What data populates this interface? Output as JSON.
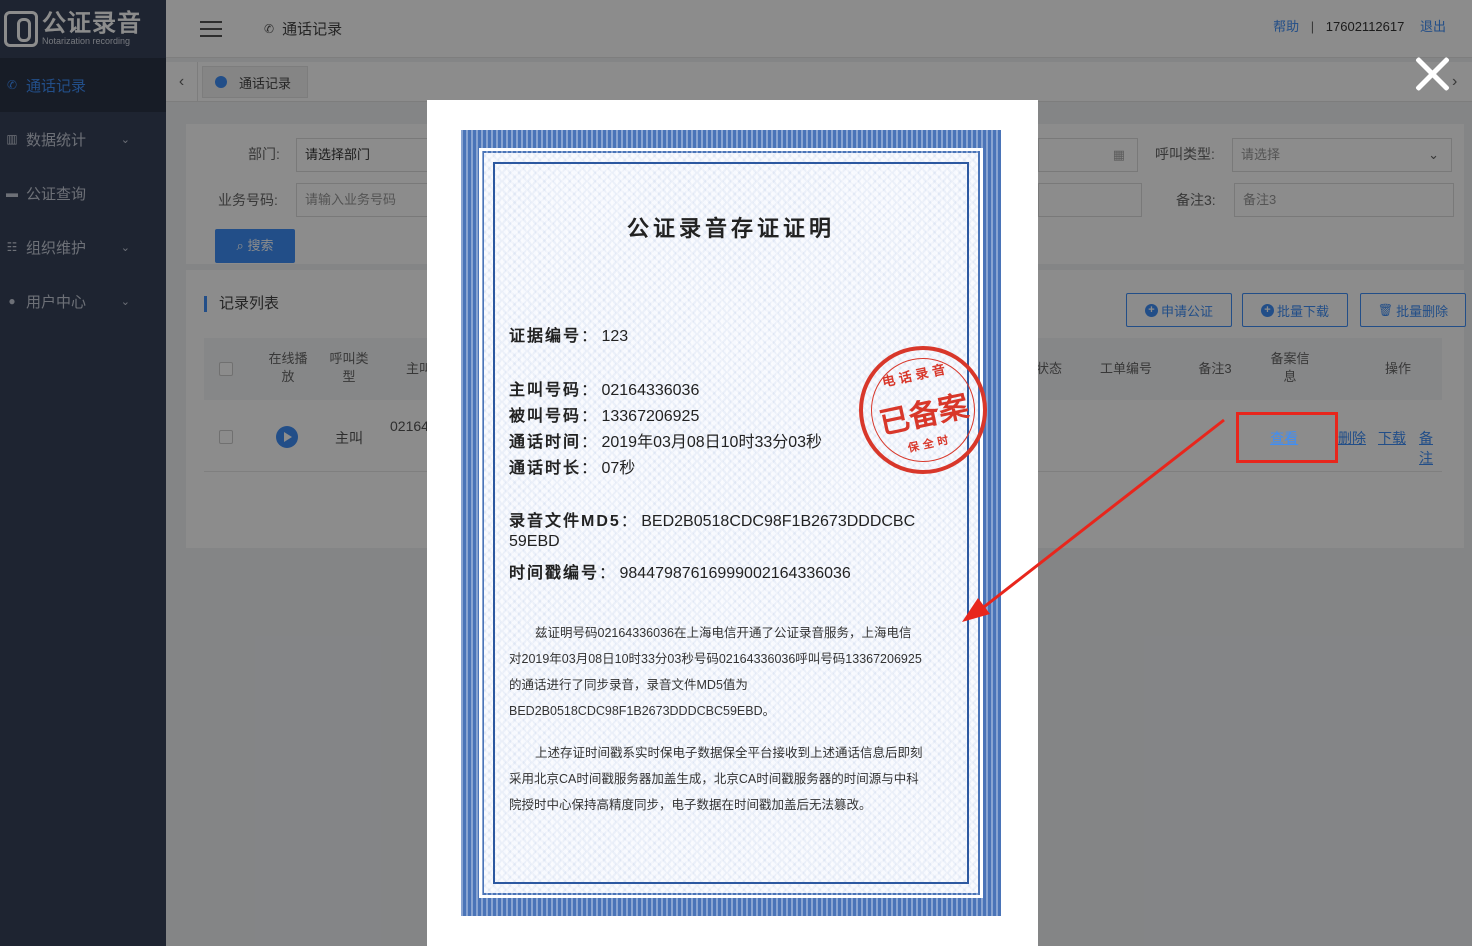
{
  "app": {
    "logo_title": "公证录音",
    "logo_sub": "Notarization recording"
  },
  "sidebar": {
    "items": [
      {
        "label": "通话记录",
        "icon": "phone-icon",
        "active": true
      },
      {
        "label": "数据统计",
        "icon": "bar-chart-icon",
        "caret": true
      },
      {
        "label": "公证查询",
        "icon": "monitor-icon"
      },
      {
        "label": "组织维护",
        "icon": "sliders-icon",
        "caret": true
      },
      {
        "label": "用户中心",
        "icon": "user-icon",
        "caret": true
      }
    ]
  },
  "header": {
    "breadcrumb": "通话记录",
    "help": "帮助",
    "separator": "|",
    "phone": "17602112617",
    "logout": "退出"
  },
  "tabs": [
    {
      "label": "通话记录"
    }
  ],
  "filters": {
    "dept_label": "部门:",
    "dept_value": "请选择部门",
    "bizno_label": "业务号码:",
    "bizno_placeholder": "请输入业务号码",
    "call_type_label": "呼叫类型:",
    "call_type_placeholder": "请选择",
    "remark3_label": "备注3:",
    "remark3_placeholder": "备注3",
    "search_label": "搜索"
  },
  "list": {
    "title": "记录列表",
    "apply_btn": "申请公证",
    "batch_download_btn": "批量下载",
    "batch_delete_btn": "批量删除",
    "columns": {
      "online_play": "在线播放",
      "call_type": "呼叫类型",
      "caller": "主叫",
      "status": "状态",
      "ticket_no": "工单编号",
      "remark3": "备注3",
      "filing_info": "备案信息",
      "actions": "操作"
    },
    "row": {
      "call_type": "主叫",
      "caller": "02164",
      "view": "查看",
      "delete": "删除",
      "download": "下载",
      "remark": "备注"
    }
  },
  "certificate": {
    "title": "公证录音存证证明",
    "evidence_label": "证据编号",
    "evidence_no": "123",
    "caller_label": "主叫号码",
    "caller_no": "02164336036",
    "callee_label": "被叫号码",
    "callee_no": "13367206925",
    "call_time_label": "通话时间",
    "call_time": "2019年03月08日10时33分03秒",
    "duration_label": "通话时长",
    "duration": "07秒",
    "md5_label": "录音文件MD5",
    "md5_line1": "BED2B0518CDC98F1B2673DDDCBC",
    "md5_line2": "59EBD",
    "ts_label": "时间戳编号",
    "ts_no": "98447987616999002164336036",
    "para1": "兹证明号码02164336036在上海电信开通了公证录音服务，上海电信对2019年03月08日10时33分03秒号码02164336036呼叫号码13367206925的通话进行了同步录音，录音文件MD5值为BED2B0518CDC98F1B2673DDDCBC59EBD。",
    "para2": "上述存证时间戳系实时保电子数据保全平台接收到上述通话信息后即刻采用北京CA时间戳服务器加盖生成，北京CA时间戳服务器的时间源与中科院授时中心保持高精度同步，电子数据在时间戳加盖后无法篡改。",
    "stamp_top": "电话录音",
    "stamp_main": "已备案",
    "stamp_bottom": "保全时"
  },
  "colors": {
    "accent": "#3e8ef7",
    "sidebar": "#37425a",
    "stamp": "#d8372a",
    "annotation": "#e8261c"
  }
}
